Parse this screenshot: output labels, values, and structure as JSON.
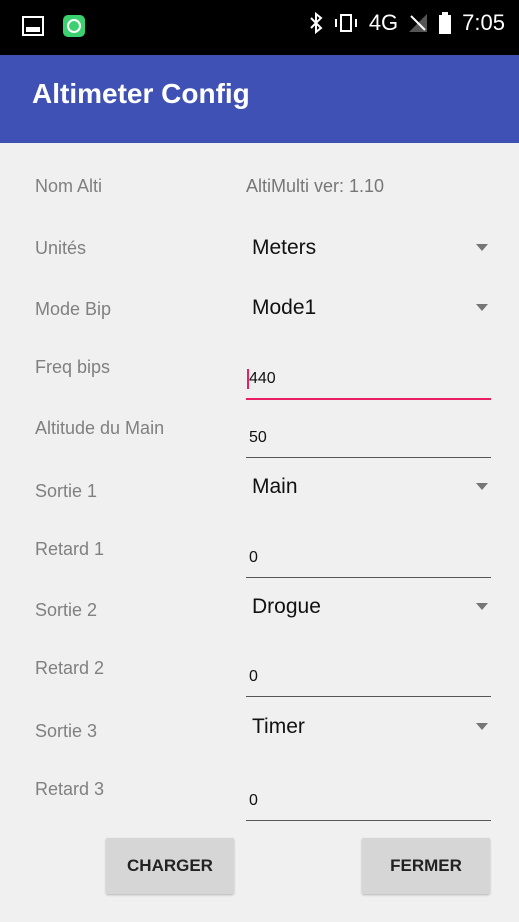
{
  "status_bar": {
    "time": "7:05",
    "network": "4G",
    "icons": [
      "image-icon",
      "app-icon",
      "bluetooth-icon",
      "vibrate-icon",
      "signal-icon",
      "battery-icon"
    ]
  },
  "app_bar": {
    "title": "Altimeter Config"
  },
  "form": {
    "nom_alti": {
      "label": "Nom Alti",
      "value": "AltiMulti ver: 1.10"
    },
    "unites": {
      "label": "Unités",
      "value": "Meters"
    },
    "mode_bip": {
      "label": "Mode Bip",
      "value": "Mode1"
    },
    "freq_bips": {
      "label": "Freq bips",
      "value": "440"
    },
    "altitude_main": {
      "label": "Altitude du Main",
      "value": "50"
    },
    "sortie1": {
      "label": "Sortie 1",
      "value": "Main"
    },
    "retard1": {
      "label": "Retard 1",
      "value": "0"
    },
    "sortie2": {
      "label": "Sortie 2",
      "value": "Drogue"
    },
    "retard2": {
      "label": "Retard 2",
      "value": "0"
    },
    "sortie3": {
      "label": "Sortie 3",
      "value": "Timer"
    },
    "retard3": {
      "label": "Retard 3",
      "value": "0"
    }
  },
  "buttons": {
    "load": "CHARGER",
    "close": "FERMER"
  },
  "colors": {
    "primary": "#3f51b5",
    "accent": "#e91e63",
    "background": "#f0f0f0"
  }
}
